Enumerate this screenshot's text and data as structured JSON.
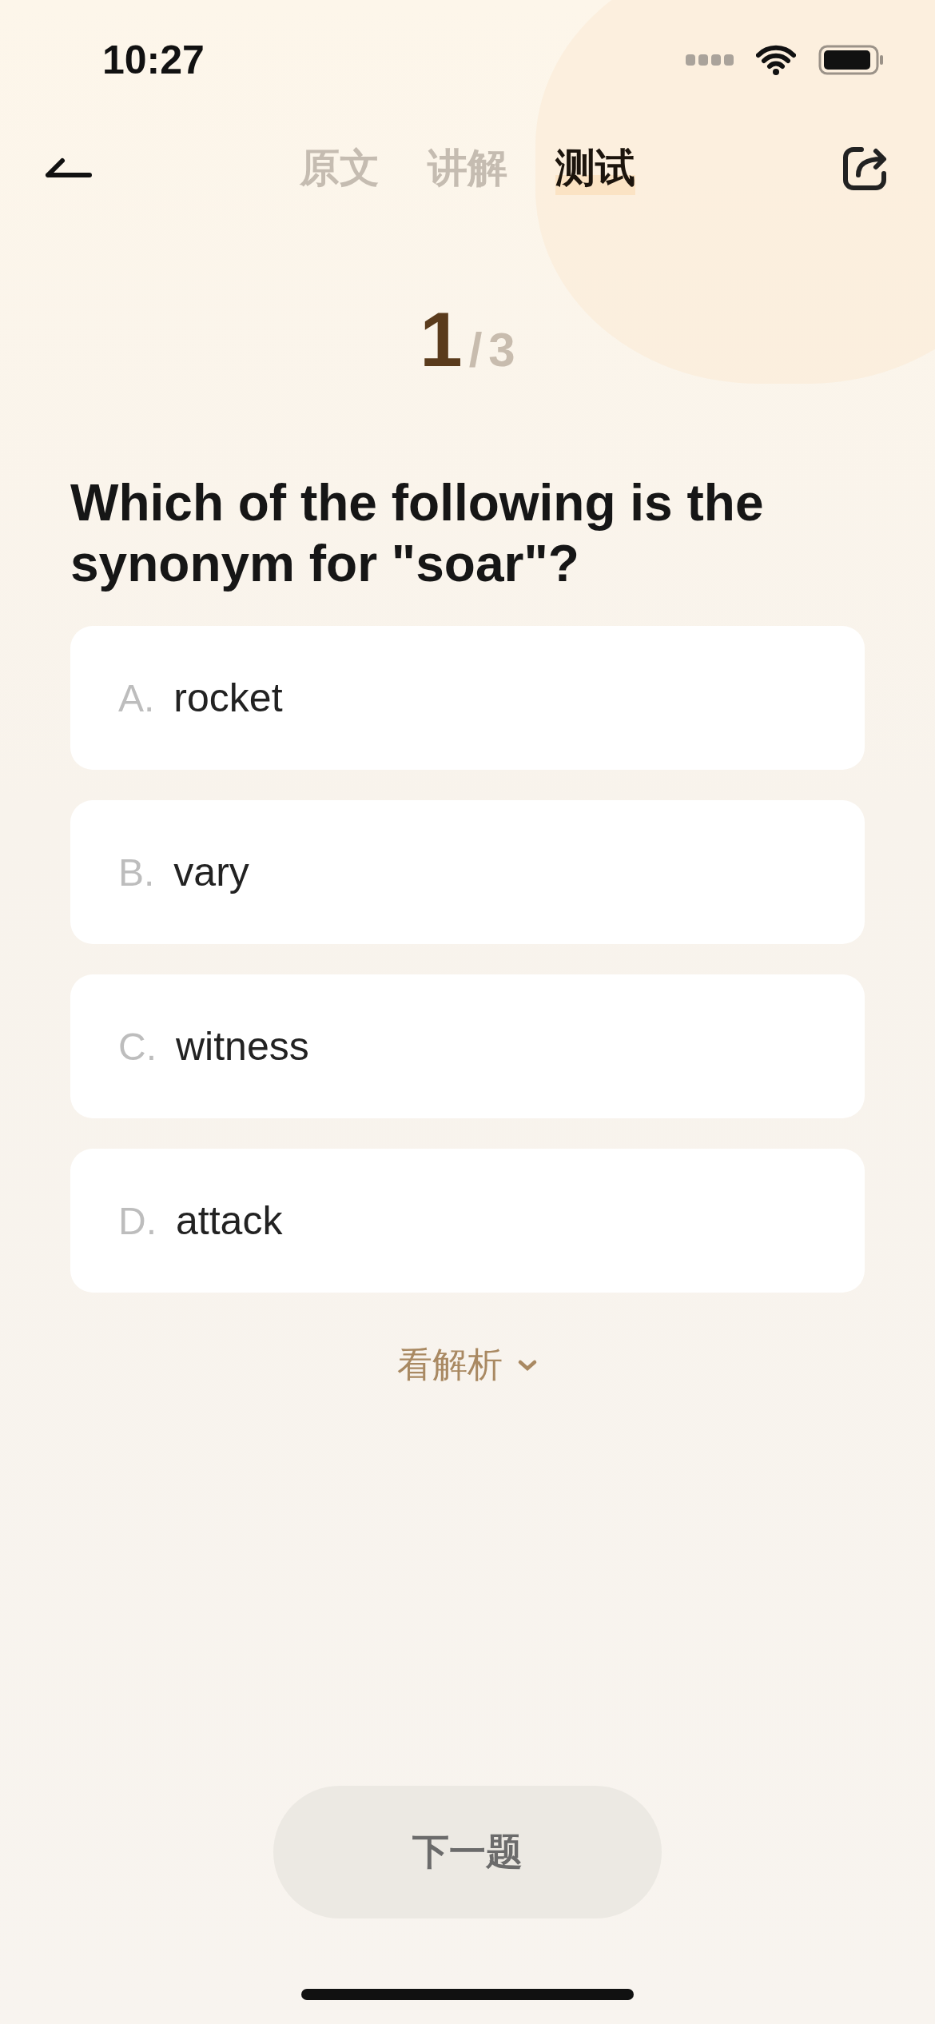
{
  "status_bar": {
    "time": "10:27"
  },
  "tabs": [
    {
      "label": "原文",
      "selected": false
    },
    {
      "label": "讲解",
      "selected": false
    },
    {
      "label": "测试",
      "selected": true
    }
  ],
  "progress": {
    "current": "1",
    "separator": "/",
    "total": "3"
  },
  "question": "Which of the following is the synonym for \"soar\"?",
  "options": [
    {
      "letter": "A.",
      "text": "rocket",
      "selected": false
    },
    {
      "letter": "B.",
      "text": "vary",
      "selected": false
    },
    {
      "letter": "C.",
      "text": "witness",
      "selected": false
    },
    {
      "letter": "D.",
      "text": "attack",
      "selected": false
    }
  ],
  "explanation_toggle": {
    "label": "看解析",
    "expanded": false
  },
  "next_button": {
    "label": "下一题",
    "disabled": true
  }
}
